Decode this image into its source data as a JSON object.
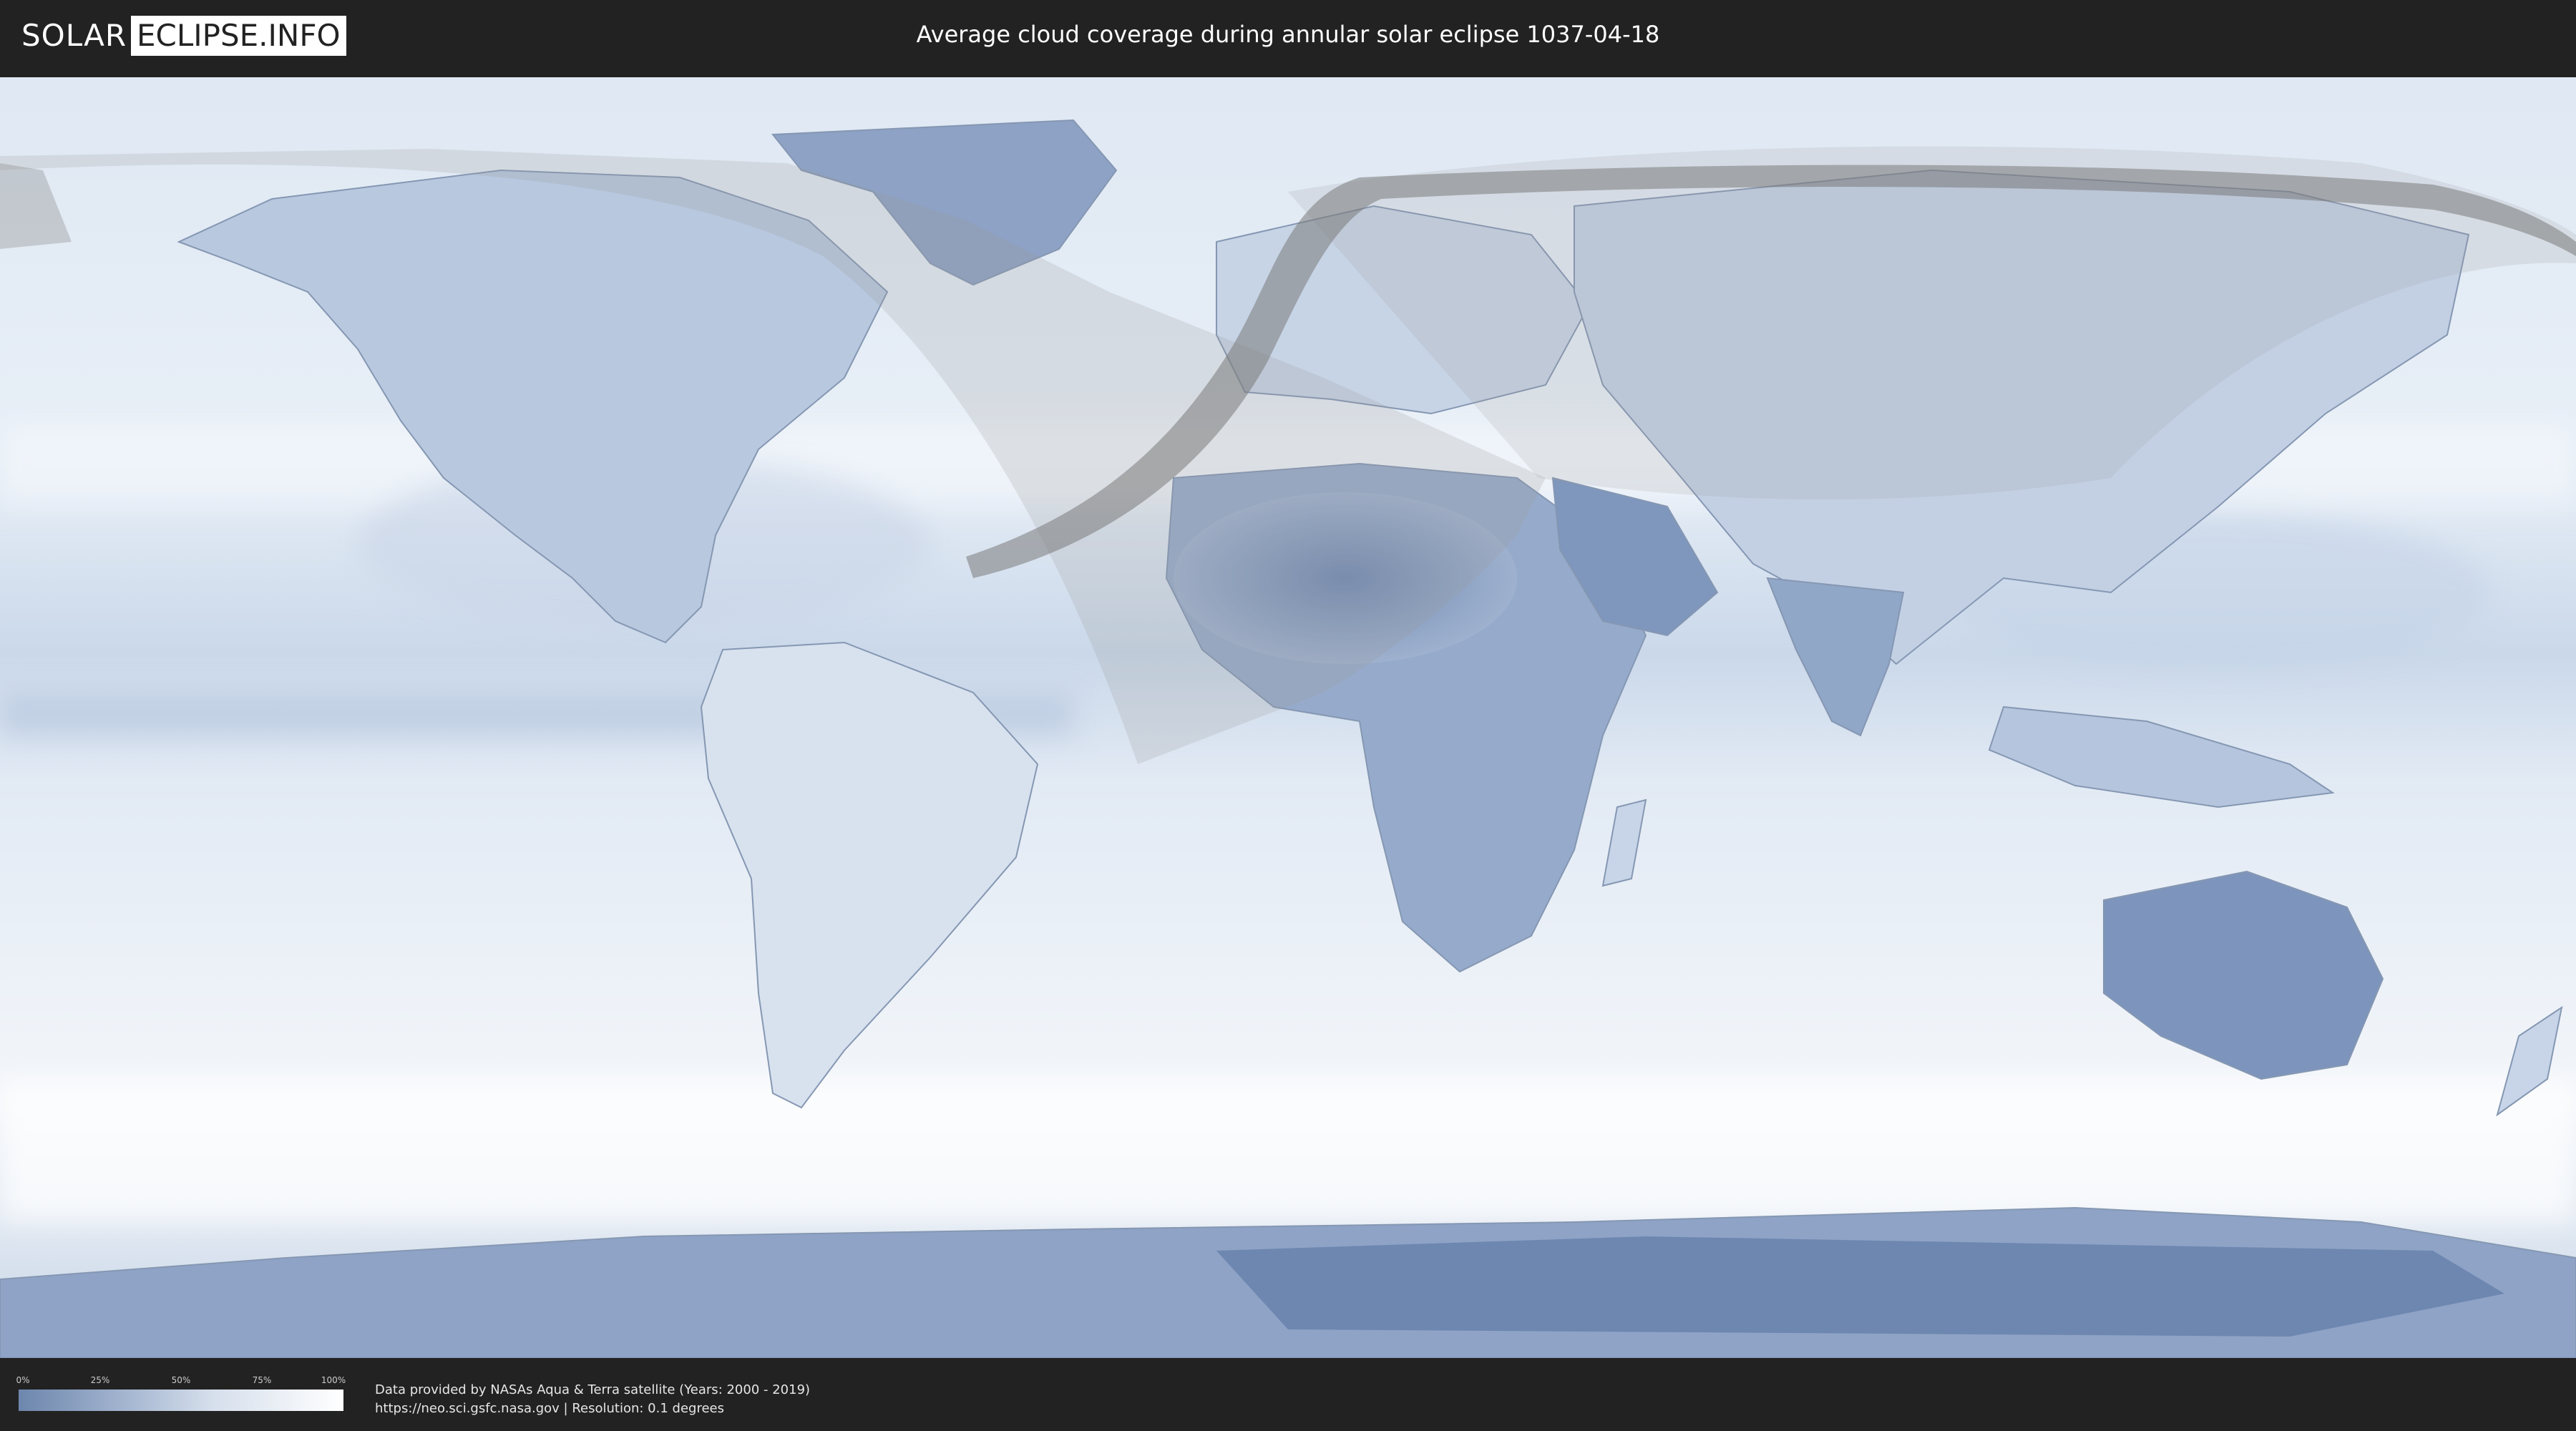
{
  "header": {
    "logo_left": "SOLAR",
    "logo_right": "ECLIPSE.INFO",
    "title": "Average cloud coverage during annular solar eclipse 1037-04-18"
  },
  "map": {
    "type": "equirectangular world map",
    "layer": "average cloud coverage",
    "colors": {
      "ocean_clouds": "#e4ecf5",
      "clear_sky": "#6d86ad",
      "overcast": "#ffffff",
      "eclipse_shade": "#9a9a9a",
      "annular_path": "#7a7a7a"
    }
  },
  "legend": {
    "ticks": [
      "0%",
      "25%",
      "50%",
      "75%",
      "100%"
    ],
    "gradient_start": "#6d86ad",
    "gradient_end": "#ffffff"
  },
  "credits": {
    "line1": "Data provided by NASAs Aqua & Terra satellite (Years: 2000 - 2019)",
    "line2": "https://neo.sci.gsfc.nasa.gov | Resolution: 0.1 degrees"
  }
}
